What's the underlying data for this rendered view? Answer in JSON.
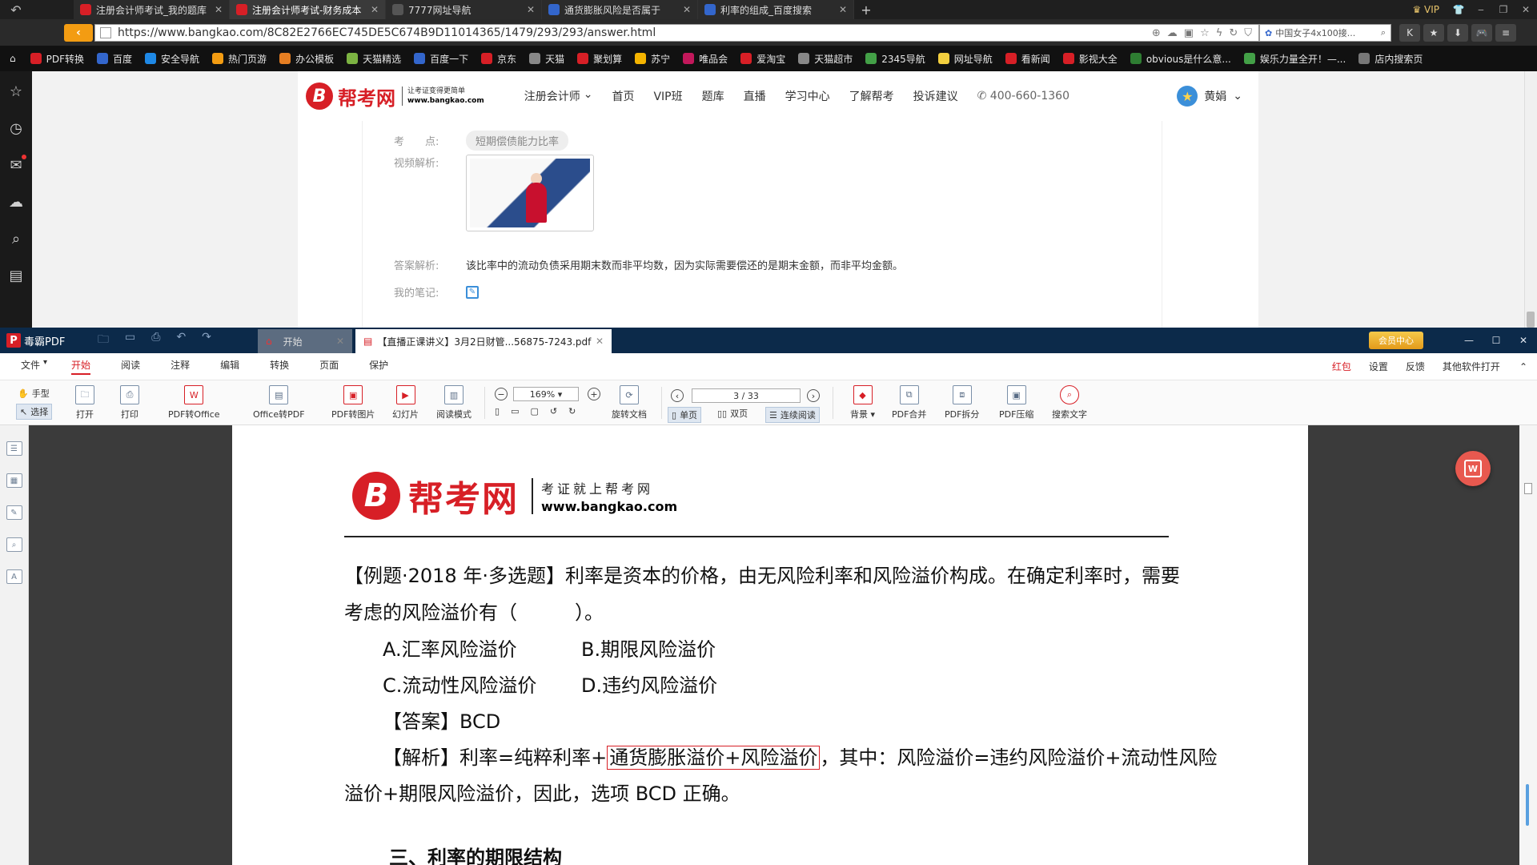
{
  "browser": {
    "tabs": [
      {
        "title": "注册会计师考试_我的题库",
        "favicon": "#d71f26",
        "active": false
      },
      {
        "title": "注册会计师考试-财务成本",
        "favicon": "#d71f26",
        "active": true
      },
      {
        "title": "7777网址导航",
        "favicon": "#555555",
        "active": false
      },
      {
        "title": "通货膨胀风险是否属于",
        "favicon": "#3366cc",
        "active": false
      },
      {
        "title": "利率的组成_百度搜索",
        "favicon": "#3366cc",
        "active": false
      }
    ],
    "new_tab": "+",
    "vip_label": "VIP",
    "url": "https://www.bangkao.com/8C82E2766EC745DE5C674B9D11014365/1479/293/293/answer.html",
    "search_placeholder": "中国女子4x100接...",
    "bookmarks": [
      {
        "label": "PDF转换",
        "color": "#d71f26"
      },
      {
        "label": "百度",
        "color": "#3366cc"
      },
      {
        "label": "安全导航",
        "color": "#1e88e5"
      },
      {
        "label": "热门页游",
        "color": "#f39c12"
      },
      {
        "label": "办公模板",
        "color": "#e67e22"
      },
      {
        "label": "天猫精选",
        "color": "#7cb342"
      },
      {
        "label": "百度一下",
        "color": "#3366cc"
      },
      {
        "label": "京东",
        "color": "#d71f26"
      },
      {
        "label": "天猫",
        "color": "#888888"
      },
      {
        "label": "聚划算",
        "color": "#d71f26"
      },
      {
        "label": "苏宁",
        "color": "#f4b400"
      },
      {
        "label": "唯品会",
        "color": "#c2185b"
      },
      {
        "label": "爱淘宝",
        "color": "#d71f26"
      },
      {
        "label": "天猫超市",
        "color": "#888888"
      },
      {
        "label": "2345导航",
        "color": "#43a047"
      },
      {
        "label": "网址导航",
        "color": "#f4d03f"
      },
      {
        "label": "看新闻",
        "color": "#d71f26"
      },
      {
        "label": "影视大全",
        "color": "#d71f26"
      },
      {
        "label": "obvious是什么意...",
        "color": "#2e7d32"
      },
      {
        "label": "娱乐力量全开！—...",
        "color": "#43a047"
      },
      {
        "label": "店内搜索页",
        "color": "#777777"
      }
    ]
  },
  "site": {
    "logo_letter": "B",
    "logo_name": "帮考网",
    "logo_tag1": "让考证变得更简单",
    "logo_tag2": "www.bangkao.com",
    "nav": [
      "注册会计师",
      "首页",
      "VIP班",
      "题库",
      "直播",
      "学习中心",
      "了解帮考",
      "投诉建议"
    ],
    "phone": "400-660-1360",
    "user": "黄娟",
    "question": {
      "topic_label": "考　　点:",
      "topic": "短期偿债能力比率",
      "video_label": "视频解析:",
      "answer_label": "答案解析:",
      "answer_text": "该比率中的流动负债采用期末数而非平均数，因为实际需要偿还的是期末金额，而非平均金额。",
      "note_label": "我的笔记:"
    }
  },
  "pdf": {
    "app_name": "毒霸PDF",
    "tabs": [
      {
        "title": "开始"
      },
      {
        "title": "【直播正课讲义】3月2日财管...56875-7243.pdf"
      }
    ],
    "member_label": "会员中心",
    "menu": [
      "文件",
      "开始",
      "阅读",
      "注释",
      "编辑",
      "转换",
      "页面",
      "保护"
    ],
    "menu_right": [
      "红包",
      "设置",
      "反馈",
      "其他软件打开"
    ],
    "tools": {
      "hand": "手型",
      "select": "选择",
      "open": "打开",
      "print": "打印",
      "pdf_to_office": "PDF转Office",
      "office_to_pdf": "Office转PDF",
      "pdf_to_image": "PDF转图片",
      "slideshow": "幻灯片",
      "read_mode": "阅读模式",
      "zoom": "169%",
      "rotate": "旋转文档",
      "page": "3 / 33",
      "single": "单页",
      "double": "双页",
      "continuous": "连续阅读",
      "background": "背景",
      "merge": "PDF合并",
      "split": "PDF拆分",
      "compress": "PDF压缩",
      "search": "搜索文字"
    },
    "page": {
      "logo_letter": "B",
      "logo_name": "帮考网",
      "logo_tag1": "考证就上帮考网",
      "logo_tag2": "www.bangkao.com",
      "line1": "【例题·2018 年·多选题】利率是资本的价格，由无风险利率和风险溢价构成。在确定利率时，需要",
      "line2": "考虑的风险溢价有（　　　）。",
      "optA": "A.汇率风险溢价",
      "optB": "B.期限风险溢价",
      "optC": "C.流动性风险溢价",
      "optD": "D.违约风险溢价",
      "answer": "【答案】BCD",
      "analysis_pre": "【解析】利率=纯粹利率+",
      "analysis_box": "通货膨胀溢价+风险溢价",
      "analysis_post": "，其中：风险溢价=违约风险溢价+流动性风险",
      "line_last": "溢价+期限风险溢价，因此，选项 BCD 正确。",
      "heading": "三、利率的期限结构"
    }
  }
}
